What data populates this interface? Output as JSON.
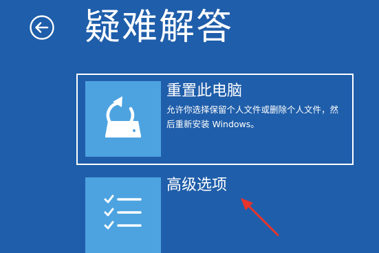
{
  "page": {
    "title": "疑难解答"
  },
  "options": {
    "reset": {
      "title": "重置此电脑",
      "description": "允许你选择保留个人文件或删除个人文件，然后重新安装 Windows。",
      "icon": "reset-pc-icon"
    },
    "advanced": {
      "title": "高级选项",
      "icon": "checklist-icon"
    }
  },
  "icons": {
    "back": "back-arrow-icon"
  },
  "colors": {
    "background": "#1f5eaa",
    "tile": "#4da3e0",
    "text": "#ffffff",
    "annotation": "#e8342b"
  }
}
